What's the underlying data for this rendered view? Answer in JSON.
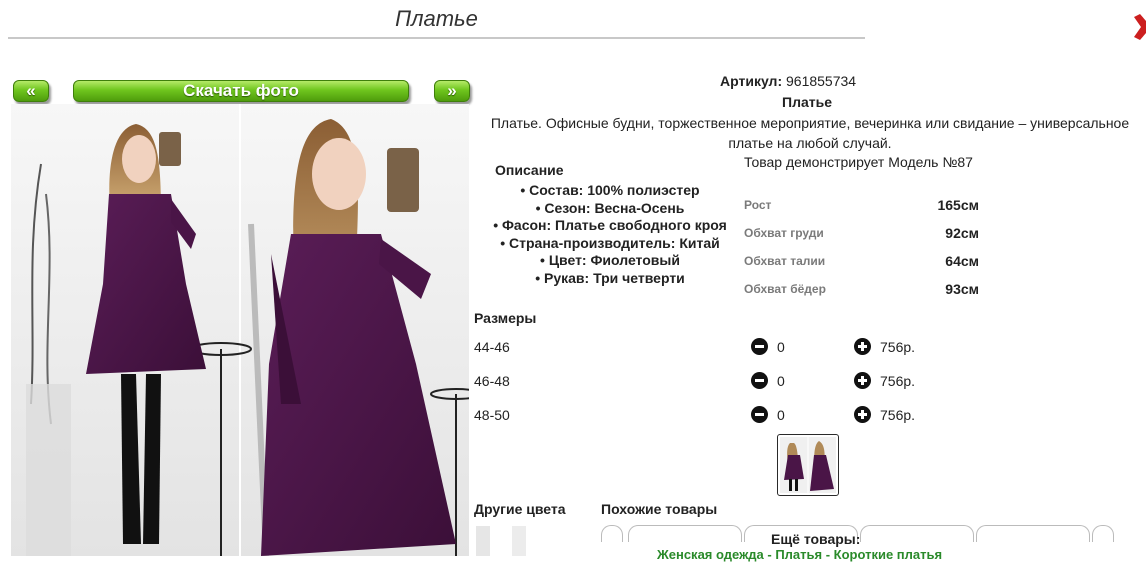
{
  "page": {
    "title": "Платье"
  },
  "gallery": {
    "prev_label": "«",
    "next_label": "»",
    "download_label": "Скачать фото"
  },
  "product": {
    "article_label": "Артикул:",
    "article_value": "961855734",
    "name": "Платье",
    "description": "Платье. Офисные будни, торжественное мероприятие, вечеринка или свидание – универсальное платье на любой случай.",
    "model_text": "Товар демонстрирует Модель №87",
    "description_heading": "Описание",
    "attributes": [
      "• Состав: 100% полиэстер",
      "• Сезон: Весна-Осень",
      "• Фасон: Платье свободного кроя",
      "• Страна-производитель: Китай",
      "• Цвет: Фиолетовый",
      "• Рукав: Три четверти"
    ],
    "model_measurements": [
      {
        "label": "Рост",
        "value": "165см"
      },
      {
        "label": "Обхват груди",
        "value": "92см"
      },
      {
        "label": "Обхват талии",
        "value": "64см"
      },
      {
        "label": "Обхват бёдер",
        "value": "93см"
      }
    ]
  },
  "sizes": {
    "heading": "Размеры",
    "rows": [
      {
        "size": "44-46",
        "qty": "0",
        "price": "756р."
      },
      {
        "size": "46-48",
        "qty": "0",
        "price": "756р."
      },
      {
        "size": "48-50",
        "qty": "0",
        "price": "756р."
      }
    ]
  },
  "bottom": {
    "other_colors": "Другие цвета",
    "similar_items": "Похожие товары",
    "more_items": "Ещё товары:",
    "more_links": "Женская одежда - Платья - Короткие платья"
  },
  "colors": {
    "accent_green": "#6fc61e",
    "link_green": "#2a8a2a",
    "dress_purple": "#4a1547",
    "close_red": "#cc1f1f"
  },
  "icons": {
    "close": "close-x-icon",
    "minus": "minus-circle-icon",
    "plus": "plus-circle-icon"
  }
}
